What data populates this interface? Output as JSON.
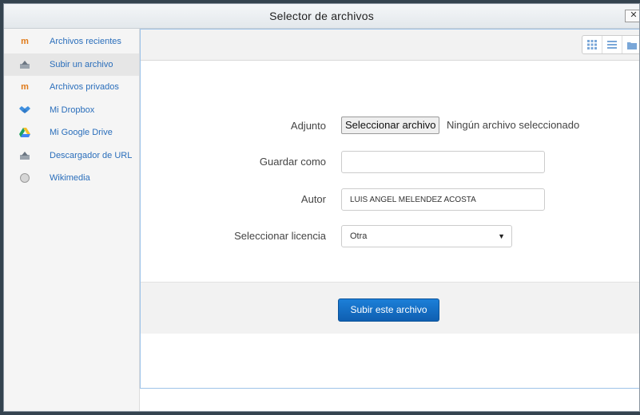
{
  "dialog": {
    "title": "Selector de archivos",
    "close_label": "✕"
  },
  "sidebar": {
    "items": [
      {
        "label": "Archivos recientes",
        "icon": "moodle-icon"
      },
      {
        "label": "Subir un archivo",
        "icon": "upload-icon"
      },
      {
        "label": "Archivos privados",
        "icon": "moodle-icon"
      },
      {
        "label": "Mi Dropbox",
        "icon": "dropbox-icon"
      },
      {
        "label": "Mi Google Drive",
        "icon": "google-drive-icon"
      },
      {
        "label": "Descargador de URL",
        "icon": "url-downloader-icon"
      },
      {
        "label": "Wikimedia",
        "icon": "wikimedia-icon"
      }
    ]
  },
  "form": {
    "attachment_label": "Adjunto",
    "file_button_label": "Seleccionar archivo",
    "file_status": "Ningún archivo seleccionado",
    "save_as_label": "Guardar como",
    "save_as_value": "",
    "author_label": "Autor",
    "author_value": "LUIS ANGEL MELENDEZ ACOSTA",
    "license_label": "Seleccionar licencia",
    "license_value": "Otra"
  },
  "actions": {
    "submit_label": "Subir este archivo"
  },
  "colors": {
    "accent": "#1a73cc",
    "link": "#2a6ebb"
  }
}
